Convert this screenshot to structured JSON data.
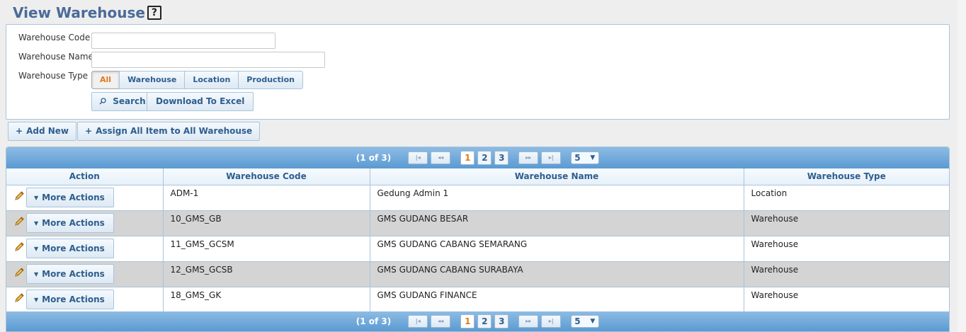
{
  "page": {
    "title": "View Warehouse",
    "help_label": "?"
  },
  "search": {
    "code_label": "Warehouse Code",
    "code_value": "",
    "name_label": "Warehouse Name",
    "name_value": "",
    "type_label": "Warehouse Type",
    "type_options": [
      "All",
      "Warehouse",
      "Location",
      "Production"
    ],
    "type_selected": "All",
    "search_button": "Search",
    "excel_button": "Download To Excel"
  },
  "toolbar": {
    "add_new": "Add New",
    "assign_all": "Assign All Item to All Warehouse"
  },
  "pager": {
    "current": "(1 of 3)",
    "first": "|◂",
    "prev": "◂◂",
    "next": "▸▸",
    "last": "▸|",
    "pages": [
      "1",
      "2",
      "3"
    ],
    "active_page": "1",
    "rows_per_page": "5"
  },
  "table": {
    "columns": [
      "Action",
      "Warehouse Code",
      "Warehouse Name",
      "Warehouse Type"
    ],
    "more_actions_label": "More Actions",
    "rows": [
      {
        "code": "ADM-1",
        "name": "Gedung Admin 1",
        "type": "Location"
      },
      {
        "code": "10_GMS_GB",
        "name": "GMS GUDANG BESAR",
        "type": "Warehouse"
      },
      {
        "code": "11_GMS_GCSM",
        "name": "GMS GUDANG CABANG SEMARANG",
        "type": "Warehouse"
      },
      {
        "code": "12_GMS_GCSB",
        "name": "GMS GUDANG CABANG SURABAYA",
        "type": "Warehouse"
      },
      {
        "code": "18_GMS_GK",
        "name": "GMS GUDANG FINANCE",
        "type": "Warehouse"
      }
    ]
  },
  "colors": {
    "accent": "#2e5e8e",
    "title": "#4a6a9a",
    "active": "#e07a1a",
    "header_blue": "#5a9ad2"
  },
  "icons": {
    "edit": "pencil-icon",
    "search": "search-icon",
    "add": "plus-icon",
    "dropdown": "triangle-down-icon"
  }
}
